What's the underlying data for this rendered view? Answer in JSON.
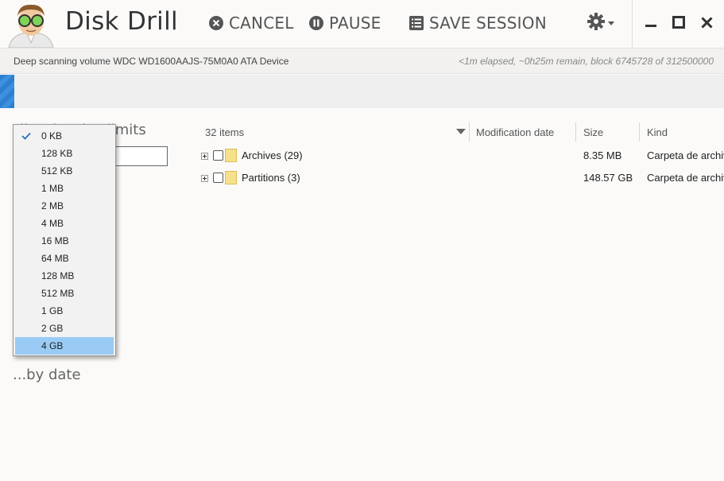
{
  "app": {
    "title": "Disk Drill"
  },
  "toolbar": {
    "cancel_label": "CANCEL",
    "pause_label": "PAUSE",
    "save_session_label": "SAVE SESSION"
  },
  "status": {
    "message": "Deep scanning volume WDC WD1600AAJS-75M0A0 ATA Device",
    "progress_text": "<1m elapsed, ~0h25m remain, block 6745728 of 312500000",
    "progress_fraction": 0.02
  },
  "sidebar": {
    "filter_title": "Filter by size limits",
    "by_date_label": "...by date"
  },
  "size_dropdown": {
    "checked_index": 0,
    "highlighted_index": 12,
    "options": [
      "0 KB",
      "128 KB",
      "512 KB",
      "1 MB",
      "2 MB",
      "4 MB",
      "16 MB",
      "64 MB",
      "128 MB",
      "512 MB",
      "1 GB",
      "2 GB",
      "4 GB"
    ]
  },
  "list": {
    "count_label": "32 items",
    "columns": {
      "modified": "Modification date",
      "size": "Size",
      "kind": "Kind"
    },
    "rows": [
      {
        "name": "Archives (29)",
        "size": "8.35 MB",
        "kind": "Carpeta de archivos"
      },
      {
        "name": "Partitions (3)",
        "size": "148.57 GB",
        "kind": "Carpeta de archivos"
      }
    ]
  },
  "colors": {
    "accent": "#3c90e0",
    "selection": "#99cbf5",
    "folder": "#f7e08a"
  }
}
